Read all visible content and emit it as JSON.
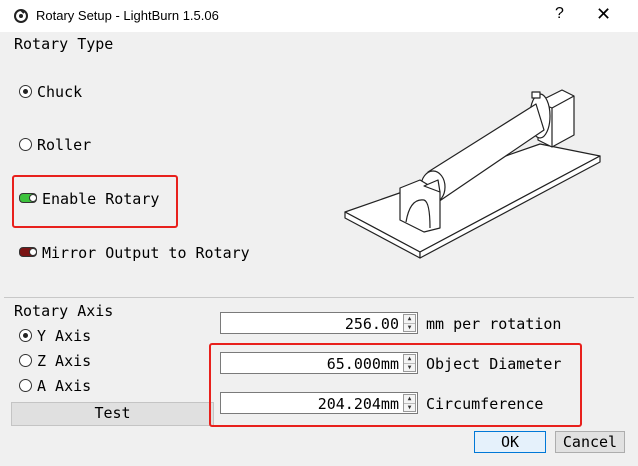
{
  "window": {
    "title": "Rotary Setup - LightBurn 1.5.06",
    "help_glyph": "?",
    "close_glyph": "✕"
  },
  "rotary_type": {
    "label": "Rotary Type",
    "options": [
      {
        "label": "Chuck",
        "selected": true
      },
      {
        "label": "Roller",
        "selected": false
      }
    ],
    "enable_rotary": {
      "label": "Enable Rotary",
      "on": true
    },
    "mirror_output": {
      "label": "Mirror Output to Rotary",
      "on": false
    }
  },
  "rotary_axis": {
    "label": "Rotary Axis",
    "options": [
      {
        "label": "Y Axis",
        "selected": true
      },
      {
        "label": "Z Axis",
        "selected": false
      },
      {
        "label": "A Axis",
        "selected": false
      }
    ],
    "test_label": "Test"
  },
  "fields": {
    "mm_per_rotation": {
      "value": "256.00",
      "label": "mm per rotation"
    },
    "object_diameter": {
      "value": "65.000mm",
      "label": "Object Diameter"
    },
    "circumference": {
      "value": "204.204mm",
      "label": "Circumference"
    }
  },
  "buttons": {
    "ok": "OK",
    "cancel": "Cancel"
  },
  "colors": {
    "highlight": "#e8201c",
    "toggle_on": "#3cc23c",
    "toggle_off": "#7a1414"
  },
  "illustration": "chuck-rotary-icon"
}
